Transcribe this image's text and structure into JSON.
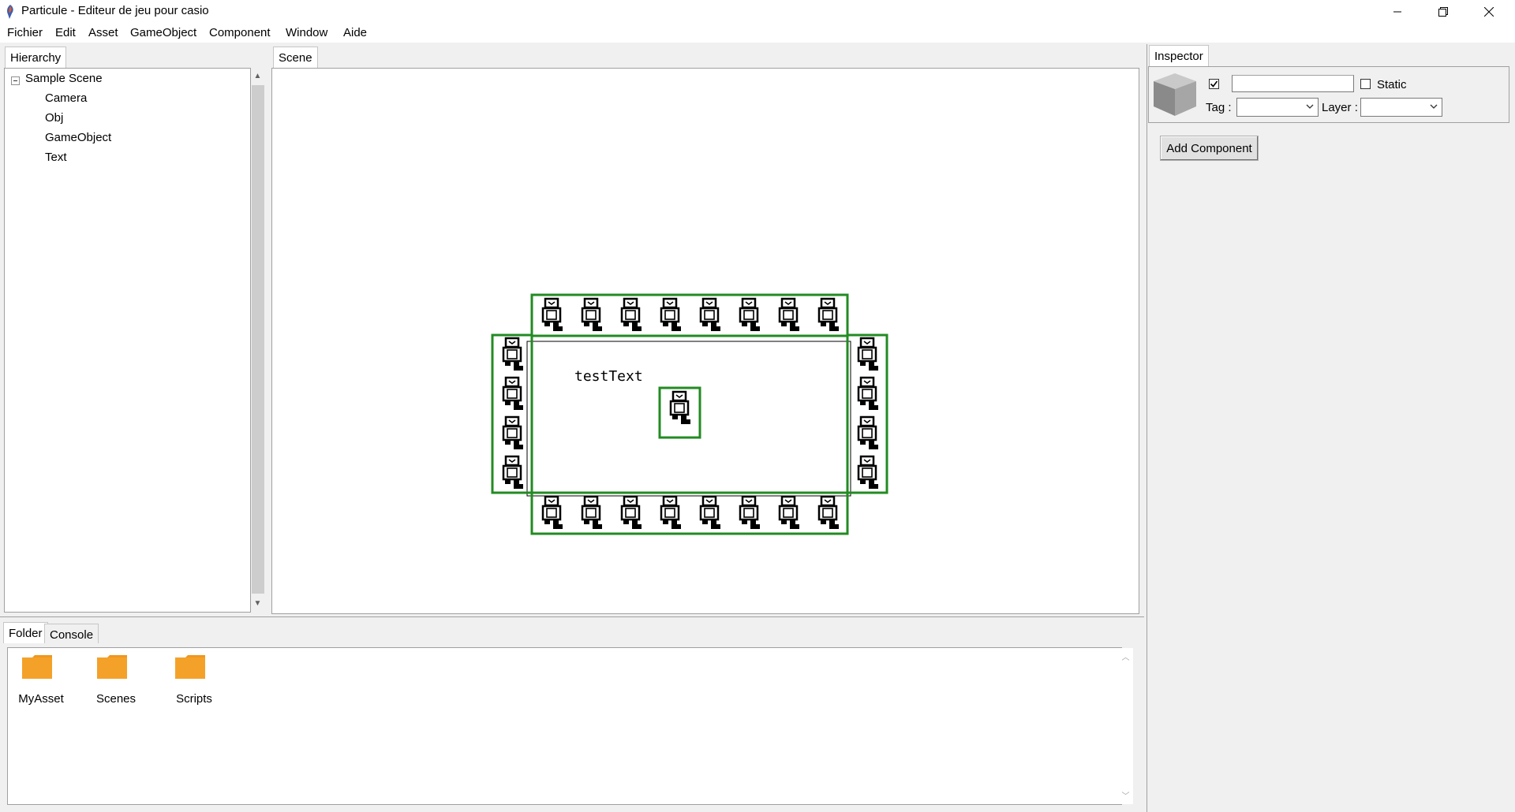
{
  "window": {
    "title": "Particule - Editeur de jeu pour casio",
    "controls": [
      "minimize-icon",
      "maximize-icon",
      "close-icon"
    ]
  },
  "menu": [
    "Fichier",
    "Edit",
    "Asset",
    "GameObject",
    "Component",
    "Window",
    "Aide"
  ],
  "hierarchy": {
    "tab": "Hierarchy",
    "root": "Sample Scene",
    "children": [
      "Camera",
      "Obj",
      "GameObject",
      "Text"
    ]
  },
  "scene": {
    "tab": "Scene",
    "text_object": "testText",
    "colors": {
      "selection": "#228b22",
      "sprite": "#000000"
    }
  },
  "inspector": {
    "tab": "Inspector",
    "active_checked": true,
    "name_value": "",
    "static_label": "Static",
    "static_checked": false,
    "tag_label": "Tag :",
    "tag_value": "",
    "layer_label": "Layer :",
    "layer_value": "",
    "add_component": "Add Component"
  },
  "bottom": {
    "tabs": [
      "Folder",
      "Console"
    ],
    "active_tab": "Folder",
    "folders": [
      "MyAsset",
      "Scenes",
      "Scripts"
    ],
    "folder_color": "#f0961e"
  }
}
